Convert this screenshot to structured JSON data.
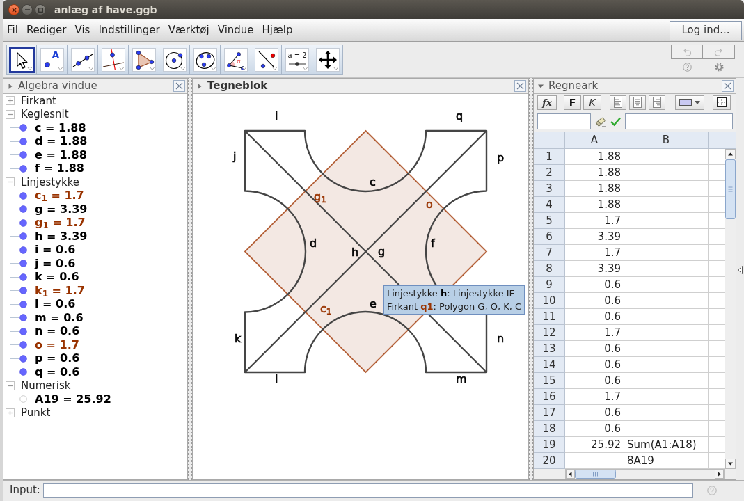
{
  "window": {
    "title": "anlæg af have.ggb"
  },
  "menu": [
    "Fil",
    "Rediger",
    "Vis",
    "Indstillinger",
    "Værktøj",
    "Vindue",
    "Hjælp"
  ],
  "login_button": {
    "label": "Log ind..."
  },
  "tools": [
    {
      "kind": "move",
      "selected": true
    },
    {
      "kind": "point",
      "label": "A",
      "selected": false
    },
    {
      "kind": "line",
      "selected": false
    },
    {
      "kind": "perpendicular",
      "selected": false
    },
    {
      "kind": "polygon",
      "selected": false
    },
    {
      "kind": "circle",
      "selected": false
    },
    {
      "kind": "conic",
      "selected": false
    },
    {
      "kind": "angle",
      "label": "α",
      "selected": false
    },
    {
      "kind": "reflect",
      "selected": false
    },
    {
      "kind": "slider",
      "label": "a = 2",
      "selected": false
    },
    {
      "kind": "move_view",
      "selected": false
    }
  ],
  "history_buttons": [
    {
      "kind": "undo",
      "disabled": true
    },
    {
      "kind": "redo",
      "disabled": true
    }
  ],
  "algebra": {
    "title": "Algebra vindue",
    "focused": false,
    "style_bar_open": false,
    "groups": [
      {
        "label": "Firkant",
        "expanded": false
      },
      {
        "label": "Keglesnit",
        "expanded": true,
        "children": [
          {
            "text": "c = 1.88",
            "color": "#000000",
            "visible": true
          },
          {
            "text": "d = 1.88",
            "color": "#000000",
            "visible": true
          },
          {
            "text": "e = 1.88",
            "color": "#000000",
            "visible": true
          },
          {
            "text": "f = 1.88",
            "color": "#000000",
            "visible": true
          }
        ]
      },
      {
        "label": "Linjestykke",
        "expanded": true,
        "children": [
          {
            "text": "c$_{1}$ = 1.7",
            "color": "#993300",
            "visible": true
          },
          {
            "text": "g = 3.39",
            "color": "#000000",
            "visible": true
          },
          {
            "text": "g$_{1}$ = 1.7",
            "color": "#993300",
            "visible": true
          },
          {
            "text": "h = 3.39",
            "color": "#000000",
            "visible": true
          },
          {
            "text": "i = 0.6",
            "color": "#000000",
            "visible": true
          },
          {
            "text": "j = 0.6",
            "color": "#000000",
            "visible": true
          },
          {
            "text": "k = 0.6",
            "color": "#000000",
            "visible": true
          },
          {
            "text": "k$_{1}$ = 1.7",
            "color": "#993300",
            "visible": true
          },
          {
            "text": "l = 0.6",
            "color": "#000000",
            "visible": true
          },
          {
            "text": "m = 0.6",
            "color": "#000000",
            "visible": true
          },
          {
            "text": "n = 0.6",
            "color": "#000000",
            "visible": true
          },
          {
            "text": "o = 1.7",
            "color": "#993300",
            "visible": true
          },
          {
            "text": "p = 0.6",
            "color": "#000000",
            "visible": true
          },
          {
            "text": "q = 0.6",
            "color": "#000000",
            "visible": true
          }
        ]
      },
      {
        "label": "Numerisk",
        "expanded": true,
        "children": [
          {
            "text": "A19 = 25.92",
            "color": "#000000",
            "visible": false
          }
        ]
      },
      {
        "label": "Punkt",
        "expanded": false
      }
    ]
  },
  "graphics": {
    "title": "Tegneblok",
    "focused": true,
    "style_bar_open": false,
    "labels": [
      {
        "text": "i",
        "color": "#000000"
      },
      {
        "text": "q",
        "color": "#000000"
      },
      {
        "text": "j",
        "color": "#000000"
      },
      {
        "text": "p",
        "color": "#000000"
      },
      {
        "text": "c",
        "color": "#000000"
      },
      {
        "text": "g$_{1}$",
        "color": "#993300"
      },
      {
        "text": "o",
        "color": "#993300"
      },
      {
        "text": "d",
        "color": "#000000"
      },
      {
        "text": "f",
        "color": "#000000"
      },
      {
        "text": "h",
        "color": "#000000"
      },
      {
        "text": "g",
        "color": "#000000"
      },
      {
        "text": "c$_{1}$",
        "color": "#993300"
      },
      {
        "text": "e",
        "color": "#000000"
      },
      {
        "text": "k",
        "color": "#000000"
      },
      {
        "text": "n",
        "color": "#000000"
      },
      {
        "text": "l",
        "color": "#000000"
      },
      {
        "text": "m",
        "color": "#000000"
      }
    ]
  },
  "tooltip": {
    "lines": [
      {
        "segments": [
          {
            "text": "Linjestykke ",
            "bold": false,
            "color": "#222222"
          },
          {
            "text": "h",
            "bold": true,
            "color": "#000000"
          },
          {
            "text": ": Linjestykke IE",
            "bold": false,
            "color": "#222222"
          }
        ]
      },
      {
        "segments": [
          {
            "text": "Firkant ",
            "bold": false,
            "color": "#222222"
          },
          {
            "text": "q1",
            "bold": true,
            "color": "#993300"
          },
          {
            "text": ": Polygon G, O, K, C",
            "bold": false,
            "color": "#222222"
          }
        ]
      }
    ]
  },
  "spreadsheet": {
    "title": "Regneark",
    "focused": false,
    "style_bar_open": true,
    "toolbar": [
      {
        "kind": "formula",
        "label": "fx"
      },
      {
        "kind": "bold",
        "label": "F"
      },
      {
        "kind": "italic",
        "label": "K"
      },
      {
        "kind": "align_left"
      },
      {
        "kind": "align_center"
      },
      {
        "kind": "align_right"
      },
      {
        "kind": "fill_color"
      },
      {
        "kind": "borders"
      }
    ],
    "columns": [
      "A",
      "B"
    ],
    "rows": [
      {
        "header": "1",
        "cell_a": "1.88"
      },
      {
        "header": "2",
        "cell_a": "1.88"
      },
      {
        "header": "3",
        "cell_a": "1.88"
      },
      {
        "header": "4",
        "cell_a": "1.88"
      },
      {
        "header": "5",
        "cell_a": "1.7"
      },
      {
        "header": "6",
        "cell_a": "3.39"
      },
      {
        "header": "7",
        "cell_a": "1.7"
      },
      {
        "header": "8",
        "cell_a": "3.39"
      },
      {
        "header": "9",
        "cell_a": "0.6"
      },
      {
        "header": "10",
        "cell_a": "0.6"
      },
      {
        "header": "11",
        "cell_a": "0.6"
      },
      {
        "header": "12",
        "cell_a": "1.7"
      },
      {
        "header": "13",
        "cell_a": "0.6"
      },
      {
        "header": "14",
        "cell_a": "0.6"
      },
      {
        "header": "15",
        "cell_a": "0.6"
      },
      {
        "header": "16",
        "cell_a": "1.7"
      },
      {
        "header": "17",
        "cell_a": "0.6"
      },
      {
        "header": "18",
        "cell_a": "0.6"
      },
      {
        "header": "19",
        "cell_a": "25.92",
        "cell_b": "Sum(A1:A18)"
      },
      {
        "header": "20",
        "cell_b": "8A19"
      }
    ]
  },
  "input_bar": {
    "label": "Input:"
  }
}
